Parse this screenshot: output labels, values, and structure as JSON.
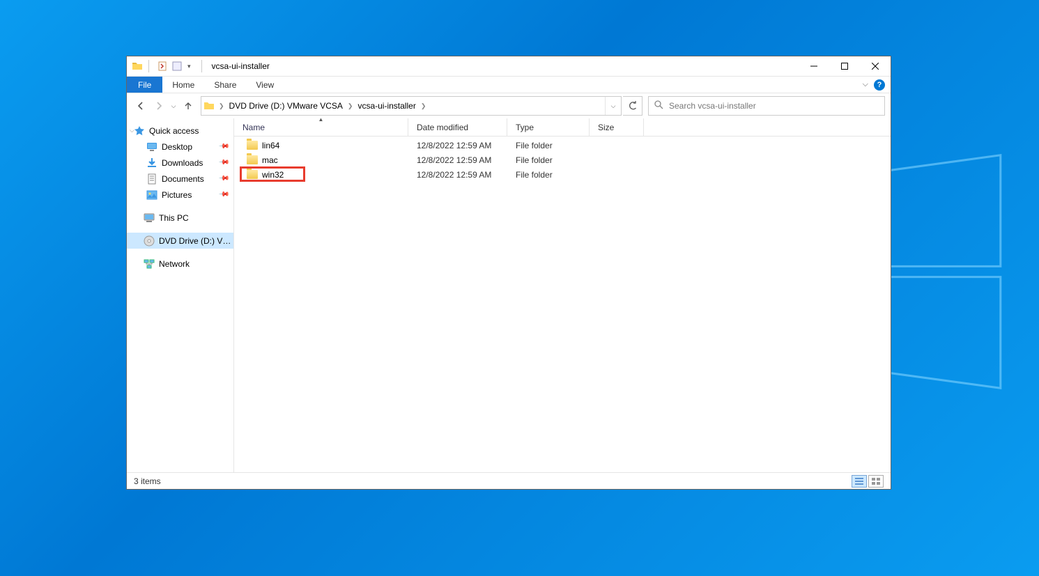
{
  "window": {
    "title": "vcsa-ui-installer"
  },
  "ribbon": {
    "file": "File",
    "tabs": [
      "Home",
      "Share",
      "View"
    ]
  },
  "breadcrumb": {
    "parts": [
      "DVD Drive (D:) VMware VCSA",
      "vcsa-ui-installer"
    ]
  },
  "search": {
    "placeholder": "Search vcsa-ui-installer"
  },
  "navpane": {
    "quick_access": "Quick access",
    "pinned": [
      {
        "label": "Desktop",
        "icon": "desktop"
      },
      {
        "label": "Downloads",
        "icon": "downloads"
      },
      {
        "label": "Documents",
        "icon": "documents"
      },
      {
        "label": "Pictures",
        "icon": "pictures"
      }
    ],
    "this_pc": "This PC",
    "dvd": "DVD Drive (D:) VMwa",
    "network": "Network"
  },
  "columns": {
    "name": "Name",
    "date": "Date modified",
    "type": "Type",
    "size": "Size"
  },
  "files": [
    {
      "name": "lin64",
      "date": "12/8/2022 12:59 AM",
      "type": "File folder",
      "highlighted": false
    },
    {
      "name": "mac",
      "date": "12/8/2022 12:59 AM",
      "type": "File folder",
      "highlighted": false
    },
    {
      "name": "win32",
      "date": "12/8/2022 12:59 AM",
      "type": "File folder",
      "highlighted": true
    }
  ],
  "status": {
    "text": "3 items"
  }
}
